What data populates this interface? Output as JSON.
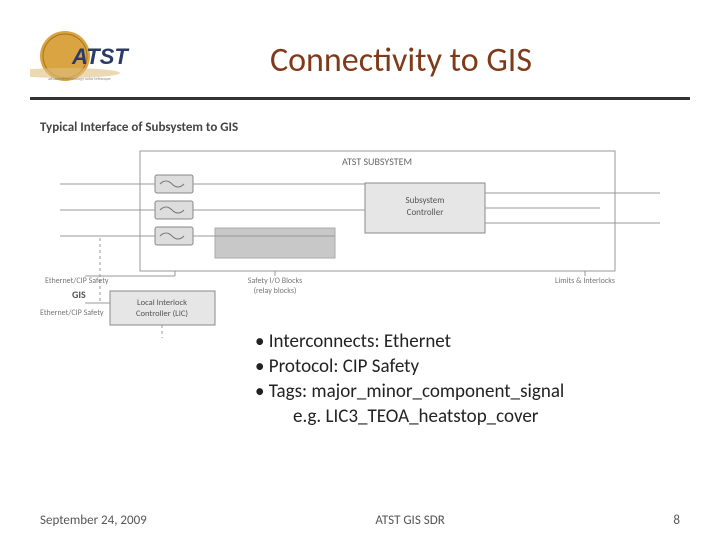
{
  "title": "Connectivity to GIS",
  "logo": {
    "text": "ATST",
    "tagline": "advanced technology solar telescope"
  },
  "figure": {
    "caption": "Typical Interface of Subsystem to GIS",
    "subsystem_box": "ATST SUBSYSTEM",
    "controller": "Subsystem\nController",
    "lic": "Local Interlock\nController (LIC)",
    "gis": "GIS",
    "left_label1": "Ethernet/CIP Safety",
    "left_label2": "Ethernet/CIP Safety",
    "bottom_mid": "Safety I/O Blocks\n(relay blocks)",
    "bottom_right": "Limits & Interlocks"
  },
  "bullets": [
    "Interconnects: Ethernet",
    "Protocol: CIP Safety",
    "Tags:  major_minor_component_signal"
  ],
  "bullet_sub": "e.g.   LIC3_TEOA_heatstop_cover",
  "footer": {
    "date": "September 24, 2009",
    "center": "ATST GIS SDR",
    "page": "8"
  }
}
